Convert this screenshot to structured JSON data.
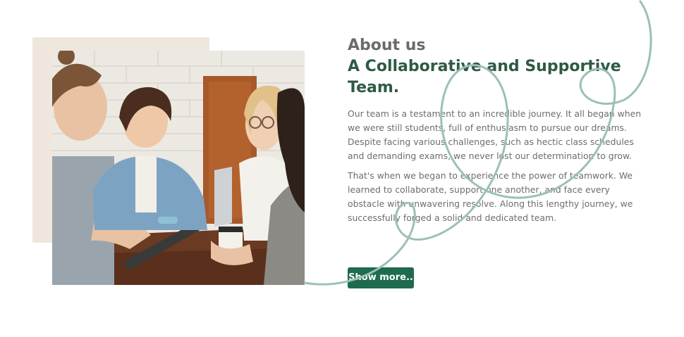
{
  "about": {
    "eyebrow": "About us",
    "headline": "A Collaborative and Supportive Team.",
    "paragraphs": [
      "Our team is a testament to an incredible journey. It all began when we were still students, full of enthusiasm to pursue our dreams. Despite facing various challenges, such as hectic class schedules and demanding exams, we never lost our determination to grow.",
      "That's when we began to experience the power of teamwork. We learned to collaborate, support one another, and face every obstacle with unwavering resolve. Along this lengthy journey, we successfully forged a solid and dedicated team."
    ],
    "cta_label": "Show more.."
  },
  "colors": {
    "accent": "#1e6b4e",
    "headline": "#2e5a44",
    "eyebrow": "#6b6b6b",
    "body_text": "#6d6d6d",
    "beige_block": "#efe6dd",
    "squiggle": "#9cc0b6"
  }
}
